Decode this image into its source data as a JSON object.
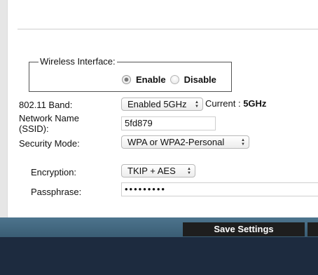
{
  "wireless_interface": {
    "legend": "Wireless Interface:",
    "options": [
      {
        "label": "Enable",
        "checked": true
      },
      {
        "label": "Disable",
        "checked": false
      }
    ]
  },
  "band": {
    "label": "802.11 Band:",
    "value": "Enabled 5GHz",
    "current_label": "Current :",
    "current_value": "5GHz"
  },
  "network_name": {
    "label_line1": "Network Name",
    "label_line2": "(SSID):",
    "value": "5fd879"
  },
  "security_mode": {
    "label": "Security Mode:",
    "value": "WPA or WPA2-Personal"
  },
  "encryption": {
    "label": "Encryption:",
    "value": "TKIP + AES"
  },
  "passphrase": {
    "label": "Passphrase:",
    "value": "•••••••••"
  },
  "footer": {
    "save_label": "Save Settings"
  },
  "colors": {
    "bar": "#3f6279",
    "button": "#1e1e1e",
    "footer": "#1d2b3f"
  }
}
